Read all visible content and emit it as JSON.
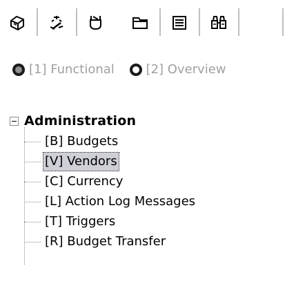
{
  "tabs": [
    {
      "icon": "book-icon",
      "active": false
    },
    {
      "icon": "wand-icon",
      "active": false
    },
    {
      "icon": "plug-icon",
      "active": true
    },
    {
      "icon": "folder-icon",
      "active": false
    },
    {
      "icon": "stack-icon",
      "active": false
    },
    {
      "icon": "binoculars-icon",
      "active": false
    }
  ],
  "view_options": [
    {
      "label": "[1] Functional",
      "selected": true
    },
    {
      "label": "[2] Overview",
      "selected": false
    }
  ],
  "tree": {
    "root_label": "Administration",
    "expanded": true,
    "items": [
      {
        "label": "[B] Budgets",
        "selected": false
      },
      {
        "label": "[V] Vendors",
        "selected": true
      },
      {
        "label": "[C] Currency",
        "selected": false
      },
      {
        "label": "[L] Action Log Messages",
        "selected": false
      },
      {
        "label": "[T] Triggers",
        "selected": false
      },
      {
        "label": "[R] Budget Transfer",
        "selected": false
      }
    ]
  },
  "colors": {
    "selection": "#cfcfd8",
    "radio_text": "#a0a0a0",
    "tree_line": "#8c8c8c"
  }
}
